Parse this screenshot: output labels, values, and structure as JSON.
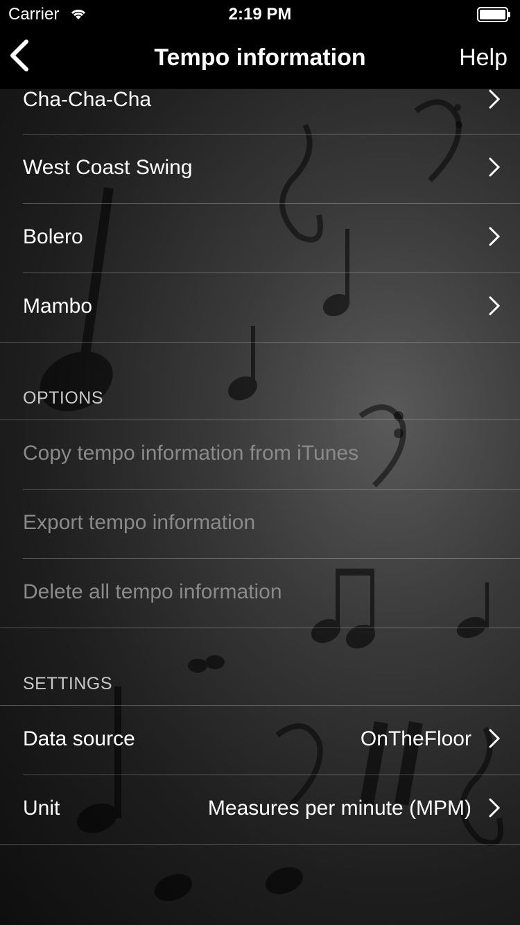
{
  "status_bar": {
    "carrier": "Carrier",
    "time": "2:19 PM"
  },
  "nav": {
    "title": "Tempo information",
    "help_label": "Help"
  },
  "dances": [
    {
      "label": "Cha-Cha-Cha"
    },
    {
      "label": "West Coast Swing"
    },
    {
      "label": "Bolero"
    },
    {
      "label": "Mambo"
    }
  ],
  "options": {
    "header": "OPTIONS",
    "items": [
      {
        "label": "Copy tempo information from iTunes"
      },
      {
        "label": "Export tempo information"
      },
      {
        "label": "Delete all tempo information"
      }
    ]
  },
  "settings": {
    "header": "SETTINGS",
    "items": [
      {
        "label": "Data source",
        "value": "OnTheFloor"
      },
      {
        "label": "Unit",
        "value": "Measures per minute (MPM)"
      }
    ]
  },
  "icons": [
    "wifi-icon",
    "battery-icon",
    "back-chevron-icon",
    "chevron-right-icon"
  ]
}
